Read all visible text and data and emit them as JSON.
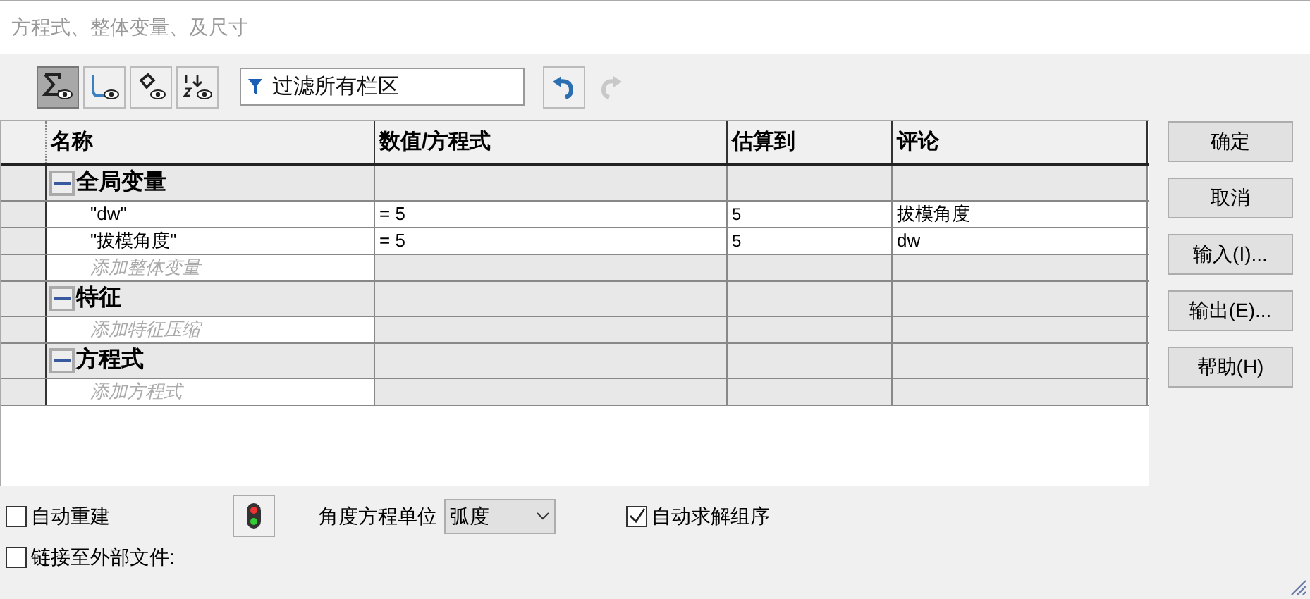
{
  "window": {
    "title": "方程式、整体变量、及尺寸"
  },
  "toolbar": {
    "views": [
      {
        "kind": "sum",
        "selected": true
      },
      {
        "kind": "sketch",
        "selected": false
      },
      {
        "kind": "feature",
        "selected": false
      },
      {
        "kind": "order",
        "selected": false
      }
    ],
    "filter": {
      "placeholder": "过滤所有栏区"
    },
    "undo": {
      "disabled": false
    },
    "redo": {
      "disabled": true
    }
  },
  "table": {
    "columns": [
      "名称",
      "数值/方程式",
      "估算到",
      "评论"
    ],
    "rows": [
      {
        "kind": "group",
        "name": "全局变量",
        "expanded": true
      },
      {
        "kind": "item",
        "name": "\"dw\"",
        "value": "= 5",
        "evaluates": "5",
        "comment": "拔模角度"
      },
      {
        "kind": "item",
        "name": "\"拔模角度\"",
        "value": "= 5",
        "evaluates": "5",
        "comment": "dw"
      },
      {
        "kind": "add",
        "name": "添加整体变量"
      },
      {
        "kind": "group",
        "name": "特征",
        "expanded": true
      },
      {
        "kind": "add",
        "name": "添加特征压缩"
      },
      {
        "kind": "group",
        "name": "方程式",
        "expanded": true
      },
      {
        "kind": "add",
        "name": "添加方程式"
      }
    ]
  },
  "buttons": [
    "确定",
    "取消",
    "输入(I)...",
    "输出(E)...",
    "帮助(H)"
  ],
  "options": {
    "auto_rebuild": {
      "label": "自动重建",
      "checked": false
    },
    "angle_unit": {
      "label": "角度方程单位",
      "value": "弧度"
    },
    "auto_solve": {
      "label": "自动求解组序",
      "checked": true
    },
    "link_file": {
      "label": "链接至外部文件:",
      "checked": false
    }
  }
}
